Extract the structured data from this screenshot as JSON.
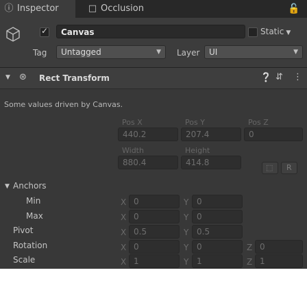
{
  "tabs": [
    {
      "label": "Inspector",
      "icon": "info-icon"
    },
    {
      "label": "Occlusion",
      "icon": "occlusion-icon"
    }
  ],
  "gameobject": {
    "name": "Canvas",
    "active": true,
    "static_label": "Static",
    "tag_label": "Tag",
    "tag_value": "Untagged",
    "layer_label": "Layer",
    "layer_value": "UI"
  },
  "component": {
    "title": "Rect Transform",
    "driven_note": "Some values driven by Canvas."
  },
  "rect": {
    "pos_x_label": "Pos X",
    "pos_x": "440.2",
    "pos_y_label": "Pos Y",
    "pos_y": "207.4",
    "pos_z_label": "Pos Z",
    "pos_z": "0",
    "width_label": "Width",
    "width": "880.4",
    "height_label": "Height",
    "height": "414.8",
    "raw_button": "R"
  },
  "anchors": {
    "label": "Anchors",
    "min_label": "Min",
    "min_x": "0",
    "min_y": "0",
    "max_label": "Max",
    "max_x": "0",
    "max_y": "0"
  },
  "pivot": {
    "label": "Pivot",
    "x": "0.5",
    "y": "0.5"
  },
  "rotation": {
    "label": "Rotation",
    "x": "0",
    "y": "0",
    "z": "0"
  },
  "scale": {
    "label": "Scale",
    "x": "1",
    "y": "1",
    "z": "1"
  },
  "axis": {
    "x": "X",
    "y": "Y",
    "z": "Z"
  }
}
